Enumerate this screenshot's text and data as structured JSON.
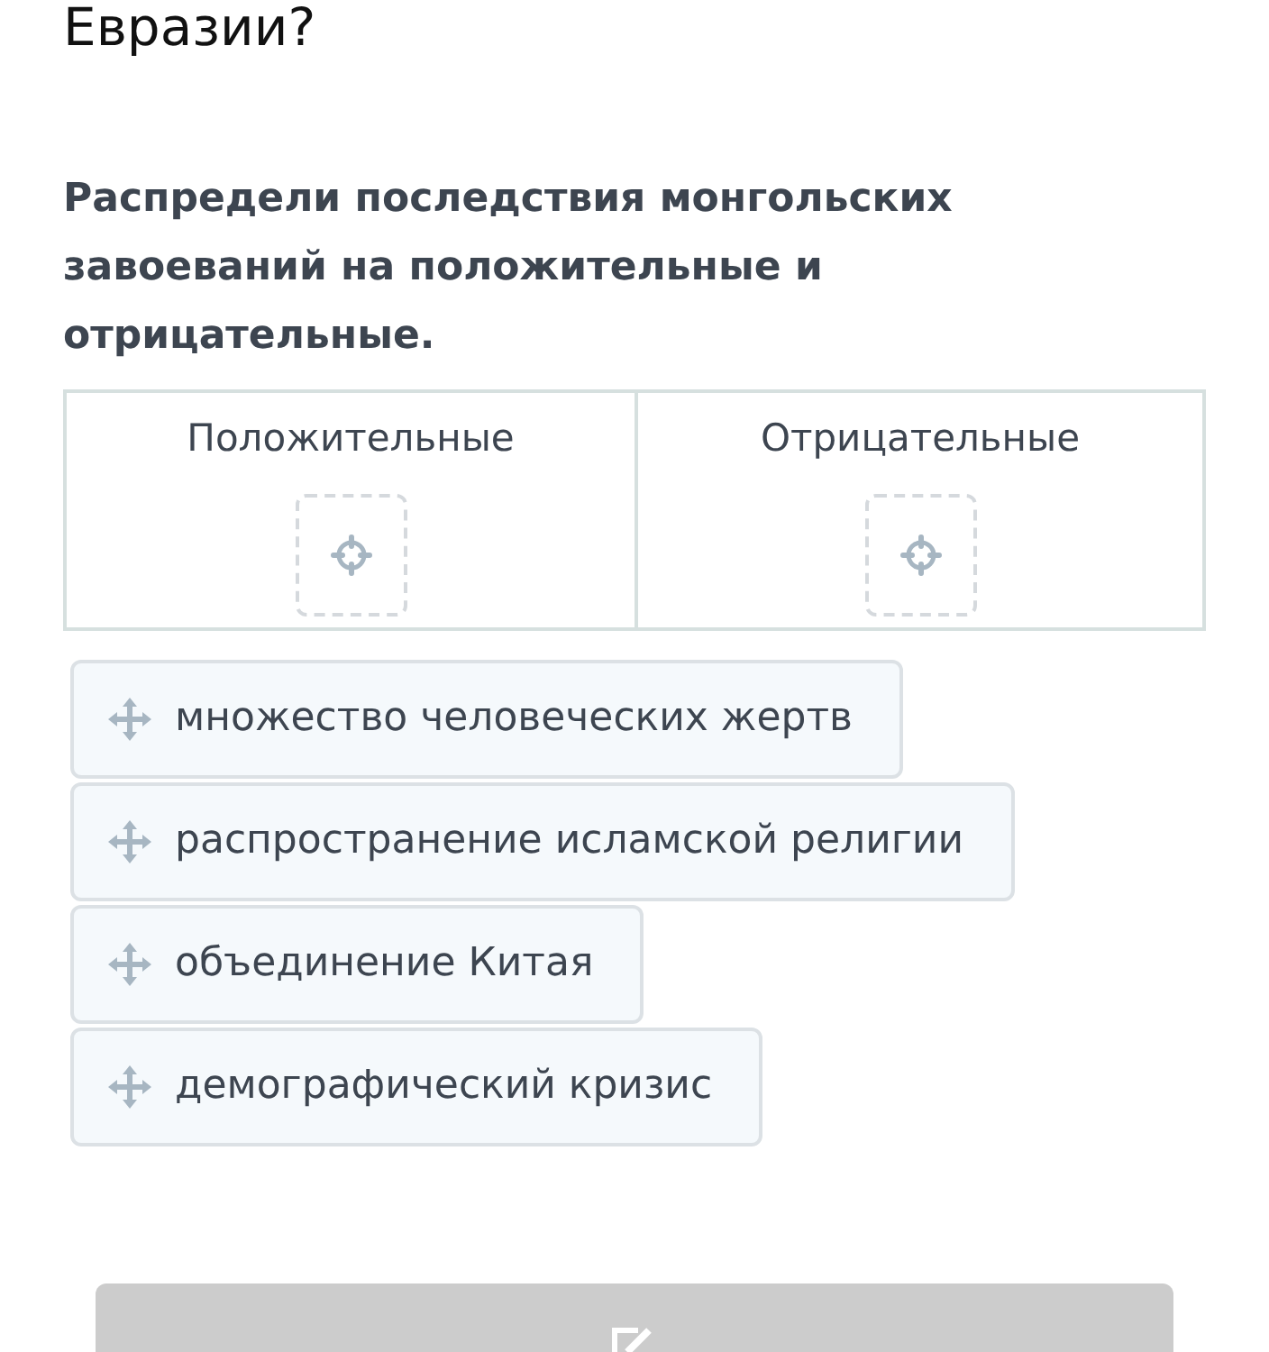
{
  "question_tail": "Евразии?",
  "instruction": "Распредели последствия монгольских завоеваний на положительные и отрицательные.",
  "columns": [
    {
      "heading": "Положительные"
    },
    {
      "heading": "Отрицательные"
    }
  ],
  "items": [
    {
      "label": "множество человеческих жертв"
    },
    {
      "label": "распространение исламской религии"
    },
    {
      "label": "объединение Китая"
    },
    {
      "label": "демографический кризис"
    }
  ],
  "submit_button": {
    "disabled": true
  }
}
